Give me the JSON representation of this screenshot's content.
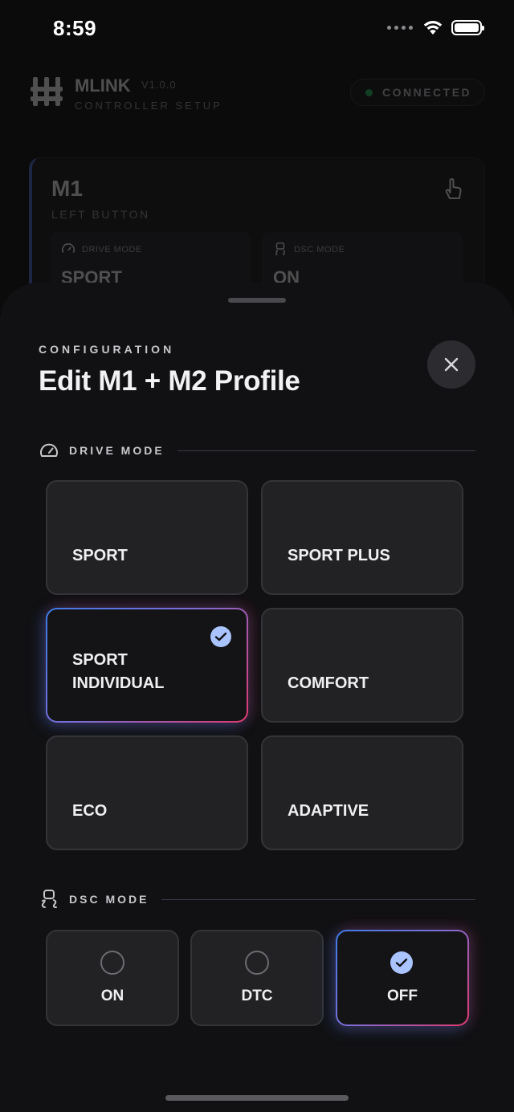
{
  "status_bar": {
    "time": "8:59"
  },
  "background": {
    "brand": "MLINK",
    "version": "V1.0.0",
    "subtitle": "CONTROLLER SETUP",
    "connection": "CONNECTED",
    "card": {
      "title": "M1",
      "subtitle": "LEFT BUTTON",
      "tiles": [
        {
          "label": "DRIVE MODE",
          "value": "SPORT"
        },
        {
          "label": "DSC MODE",
          "value": "ON"
        }
      ]
    }
  },
  "sheet": {
    "eyebrow": "CONFIGURATION",
    "title": "Edit M1 + M2 Profile",
    "drive_mode": {
      "label": "DRIVE MODE",
      "options": [
        "SPORT",
        "SPORT PLUS",
        "SPORT INDIVIDUAL",
        "COMFORT",
        "ECO",
        "ADAPTIVE"
      ],
      "selected": "SPORT INDIVIDUAL"
    },
    "dsc_mode": {
      "label": "DSC MODE",
      "options": [
        "ON",
        "DTC",
        "OFF"
      ],
      "selected": "OFF"
    }
  },
  "colors": {
    "accent_blue": "#3f7be8",
    "accent_pink": "#e23a6f",
    "check_fill": "#a9c4ff",
    "connected_green": "#22c55e"
  }
}
